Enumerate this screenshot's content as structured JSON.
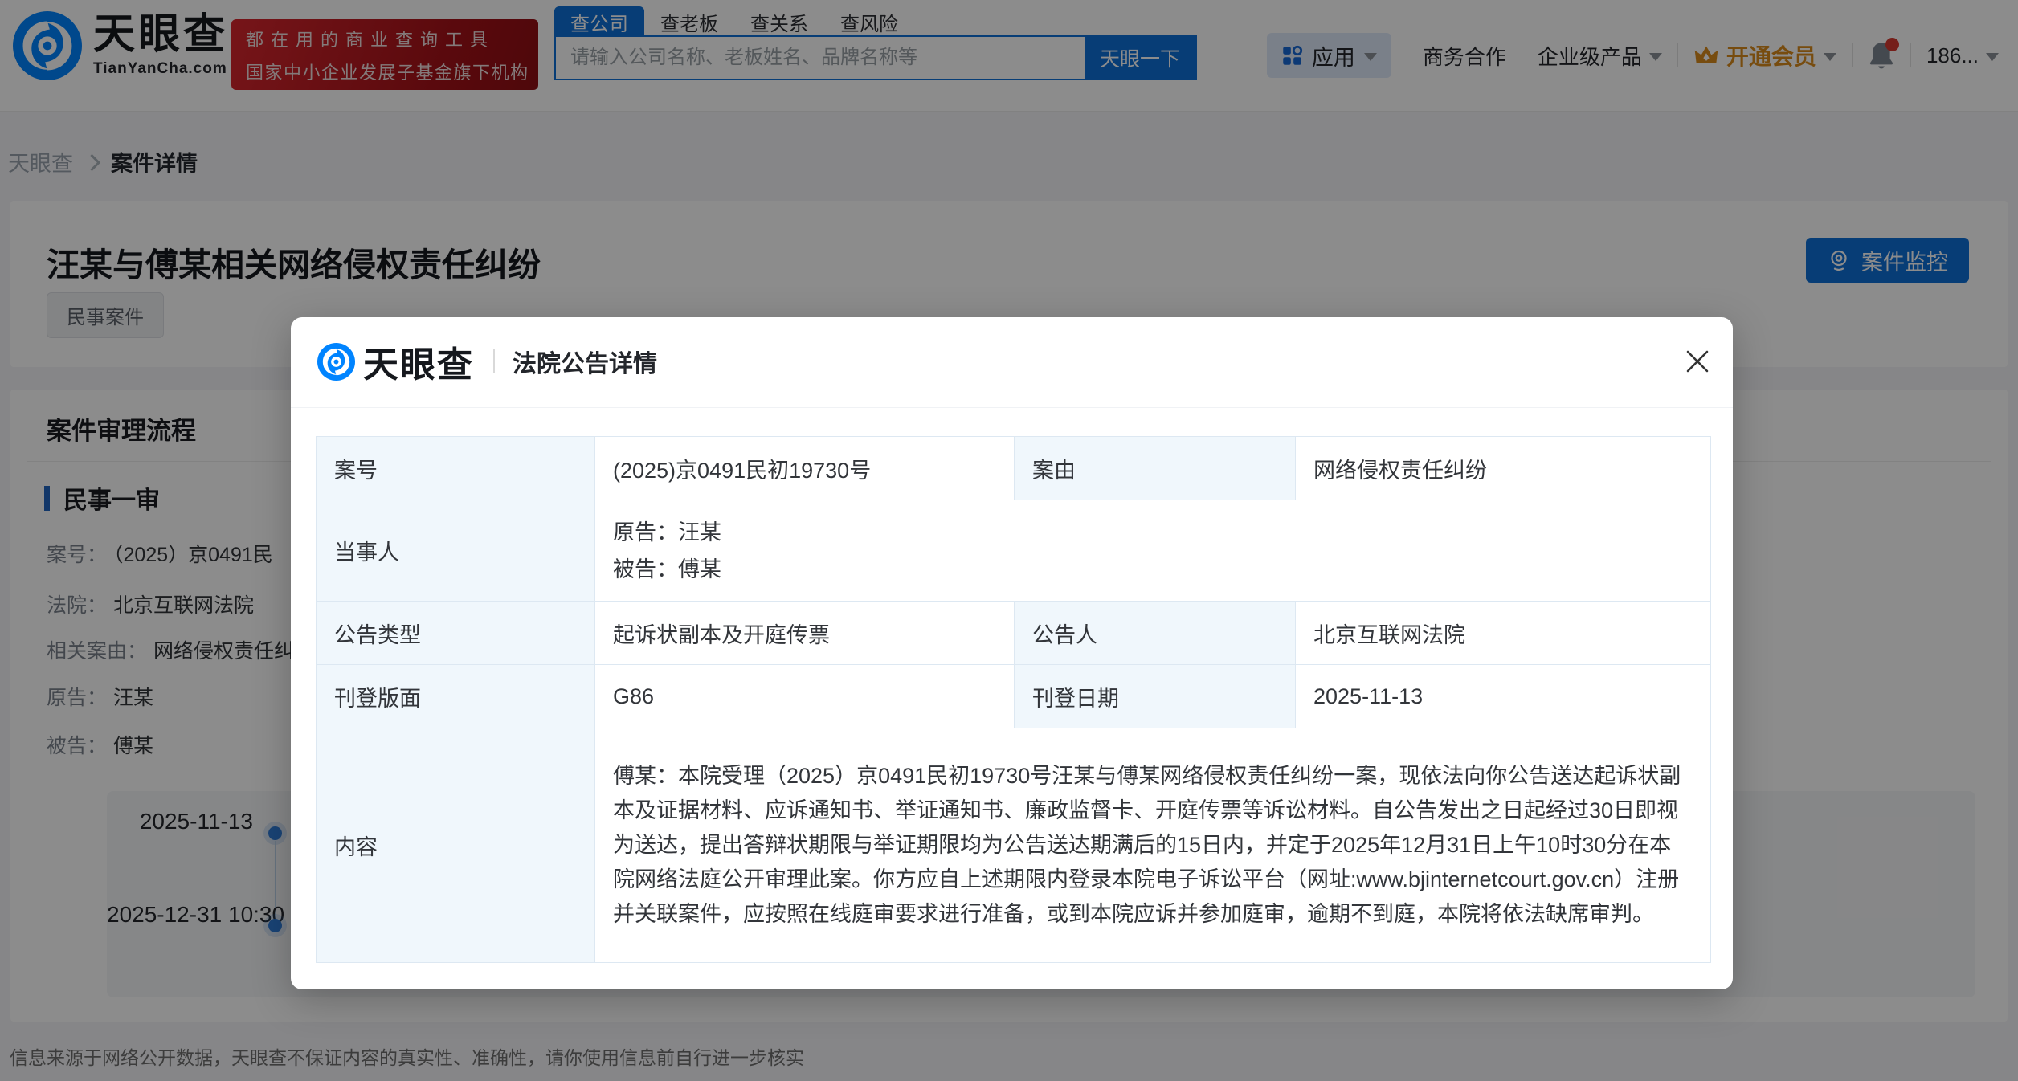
{
  "colors": {
    "brand_blue": "#0084ff",
    "accent_blue": "#0d6fd8",
    "vip_orange": "#d98a1c",
    "banner_red": "#bf161d",
    "alert_red": "#d63a30"
  },
  "header": {
    "brand": "天眼查",
    "brand_domain": "TianYanCha.com",
    "banner_line1": "都在用的商业查询工具",
    "banner_line2": "国家中小企业发展子基金旗下机构",
    "search": {
      "tabs": [
        {
          "label": "查公司",
          "active": true
        },
        {
          "label": "查老板",
          "active": false
        },
        {
          "label": "查关系",
          "active": false
        },
        {
          "label": "查风险",
          "active": false
        }
      ],
      "placeholder": "请输入公司名称、老板姓名、品牌名称等",
      "button": "天眼一下"
    },
    "nav": {
      "apps": "应用",
      "cooperation": "商务合作",
      "enterprise": "企业级产品",
      "vip": "开通会员",
      "account": "186..."
    }
  },
  "breadcrumb": {
    "home": "天眼查",
    "current": "案件详情"
  },
  "case": {
    "title": "汪某与傅某相关网络侵权责任纠纷",
    "tag": "民事案件",
    "monitor": "案件监控"
  },
  "flow": {
    "section": "案件审理流程",
    "stage": "民事一审",
    "fields": [
      {
        "label": "案号：",
        "value": "（2025）京0491民"
      },
      {
        "label": "法院：",
        "value": "北京互联网法院"
      },
      {
        "label": "相关案由：",
        "value": "网络侵权责任纠"
      },
      {
        "label": "原告：",
        "value": "汪某"
      },
      {
        "label": "被告：",
        "value": "傅某"
      }
    ],
    "timeline": [
      {
        "date": "2025-11-13"
      },
      {
        "date": "2025-12-31 10:30"
      }
    ]
  },
  "modal": {
    "brand": "天眼查",
    "title": "法院公告详情",
    "table": {
      "case_no_label": "案号",
      "case_no": "(2025)京0491民初19730号",
      "cause_label": "案由",
      "cause": "网络侵权责任纠纷",
      "party_label": "当事人",
      "party_plaintiff": "原告：汪某",
      "party_defendant": "被告：傅某",
      "type_label": "公告类型",
      "type": "起诉状副本及开庭传票",
      "announcer_label": "公告人",
      "announcer": "北京互联网法院",
      "page_label": "刊登版面",
      "page": "G86",
      "date_label": "刊登日期",
      "date": "2025-11-13",
      "content_label": "内容",
      "content": "傅某：本院受理（2025）京0491民初19730号汪某与傅某网络侵权责任纠纷一案，现依法向你公告送达起诉状副本及证据材料、应诉通知书、举证通知书、廉政监督卡、开庭传票等诉讼材料。自公告发出之日起经过30日即视为送达，提出答辩状期限与举证期限均为公告送达期满后的15日内，并定于2025年12月31日上午10时30分在本院网络法庭公开审理此案。你方应自上述期限内登录本院电子诉讼平台（网址:www.bjinternetcourt.gov.cn）注册并关联案件，应按照在线庭审要求进行准备，或到本院应诉并参加庭审，逾期不到庭，本院将依法缺席审判。"
    }
  },
  "footer": {
    "disclaimer": "信息来源于网络公开数据，天眼查不保证内容的真实性、准确性，请你使用信息前自行进一步核实"
  }
}
